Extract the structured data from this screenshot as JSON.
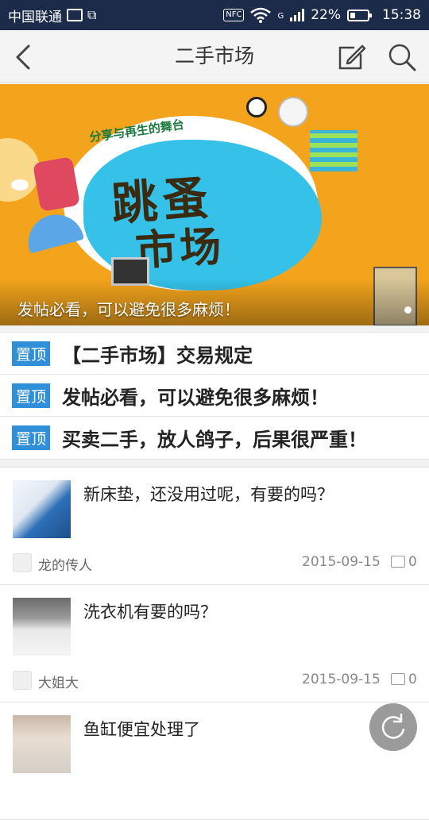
{
  "status_bar": {
    "carrier": "中国联通",
    "nfc": "NFC",
    "network": "G",
    "battery": "22%",
    "time": "15:38"
  },
  "nav": {
    "title": "二手市场",
    "back_icon": "back-arrow-icon",
    "edit_icon": "edit-icon",
    "search_icon": "search-icon"
  },
  "banner": {
    "slogan": "分享与再生的舞台",
    "headline_line1": "跳蚤",
    "headline_line2": "市场",
    "caption": "发帖必看，可以避免很多麻烦！"
  },
  "pinned": [
    {
      "tag": "置顶",
      "text": "【二手市场】交易规定"
    },
    {
      "tag": "置顶",
      "text": "发帖必看，可以避免很多麻烦！"
    },
    {
      "tag": "置顶",
      "text": "买卖二手，放人鸽子，后果很严重！"
    }
  ],
  "posts": [
    {
      "title": "新床垫，还没用过呢，有要的吗？",
      "author": "龙的传人",
      "date": "2015-09-15",
      "comments": "0"
    },
    {
      "title": "洗衣机有要的吗？",
      "author": "大姐大",
      "date": "2015-09-15",
      "comments": "0"
    },
    {
      "title": "鱼缸便宜处理了",
      "author": "",
      "date": "",
      "comments": ""
    }
  ],
  "colors": {
    "status_bar_bg": "#1d2b4a",
    "pin_tag_bg": "#2f8fd8",
    "banner_bg": "#f3a41c"
  }
}
